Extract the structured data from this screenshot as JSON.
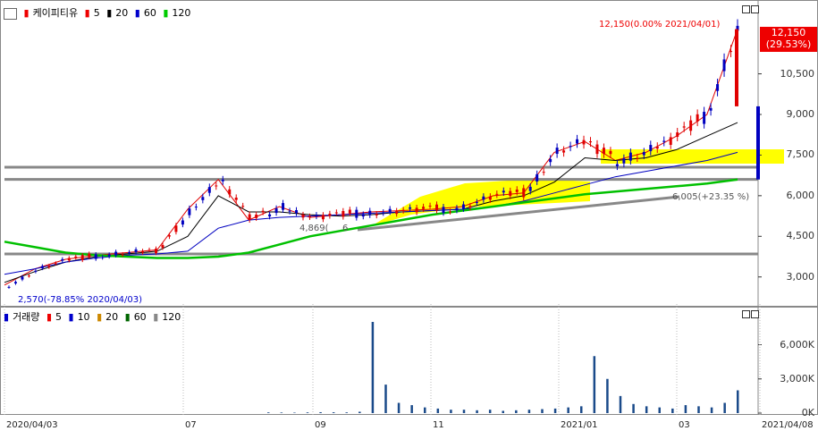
{
  "price_legend": {
    "name": "케이피티유",
    "ma5": "5",
    "ma20": "20",
    "ma60": "60",
    "ma120": "120"
  },
  "volume_legend": {
    "name": "거래량",
    "ma5": "5",
    "ma10": "10",
    "ma20": "20",
    "ma60": "60",
    "ma120": "120"
  },
  "colors": {
    "ma5": "#e00000",
    "ma20": "#000000",
    "ma60": "#0000c0",
    "ma120": "#00c000",
    "up": "#e00000",
    "down": "#0000c0",
    "highlight": "#ffff00",
    "hline": "#888888"
  },
  "price_box": {
    "price": "12,150",
    "pct": "(29.53%)"
  },
  "annotations": {
    "max_label": "12,150(0.00% 2021/04/01)",
    "min_label": "2,570(-78.85% 2020/04/03)",
    "mid_label": "4,869(",
    "mid_label2": "6",
    "right_label": "6,005(+23.35 %)"
  },
  "chart_data": [
    {
      "type": "line",
      "title": "케이피티유",
      "x_labels": [
        "2020/04/03",
        "07",
        "09",
        "11",
        "2021/01",
        "03",
        "2021/04/08"
      ],
      "y_ticks": [
        "3,000",
        "4,500",
        "6,000",
        "7,500",
        "9,000",
        "10,500"
      ],
      "ylim": [
        2000,
        12500
      ],
      "series": [
        {
          "name": "5",
          "values": [
            2700,
            3300,
            3650,
            3800,
            3900,
            4000,
            5500,
            6600,
            5100,
            5600,
            5200,
            5300,
            5400,
            5450,
            5500,
            5600,
            6000,
            6100,
            7600,
            8000,
            7300,
            7600,
            8200,
            9000,
            12150
          ]
        },
        {
          "name": "20",
          "values": [
            2800,
            3200,
            3550,
            3750,
            3850,
            3950,
            4500,
            6000,
            5400,
            5400,
            5300,
            5250,
            5300,
            5400,
            5450,
            5500,
            5800,
            6000,
            6500,
            7400,
            7300,
            7400,
            7700,
            8200,
            8700
          ]
        },
        {
          "name": "60",
          "values": [
            3100,
            3300,
            3550,
            3700,
            3800,
            3850,
            3950,
            4800,
            5100,
            5200,
            5250,
            5300,
            5350,
            5400,
            5450,
            5500,
            5600,
            5800,
            6100,
            6400,
            6700,
            6900,
            7100,
            7300,
            7600
          ]
        },
        {
          "name": "120",
          "values": [
            4300,
            4100,
            3900,
            3800,
            3750,
            3700,
            3700,
            3750,
            3900,
            4200,
            4500,
            4700,
            4900,
            5100,
            5300,
            5450,
            5600,
            5750,
            5900,
            6050,
            6150,
            6250,
            6350,
            6450,
            6600
          ]
        }
      ]
    },
    {
      "type": "bar",
      "title": "거래량",
      "y_ticks": [
        "0K",
        "3,000K",
        "6,000K"
      ],
      "ylim": [
        0,
        8000
      ],
      "values": [
        60,
        50,
        40,
        60,
        80,
        70,
        60,
        120,
        8000,
        2500,
        900,
        700,
        500,
        400,
        300,
        300,
        250,
        300,
        200,
        250,
        300,
        350,
        400,
        500,
        600,
        5000,
        3000,
        1500,
        800,
        600,
        500,
        400,
        700,
        600,
        500,
        900,
        2000
      ]
    }
  ]
}
